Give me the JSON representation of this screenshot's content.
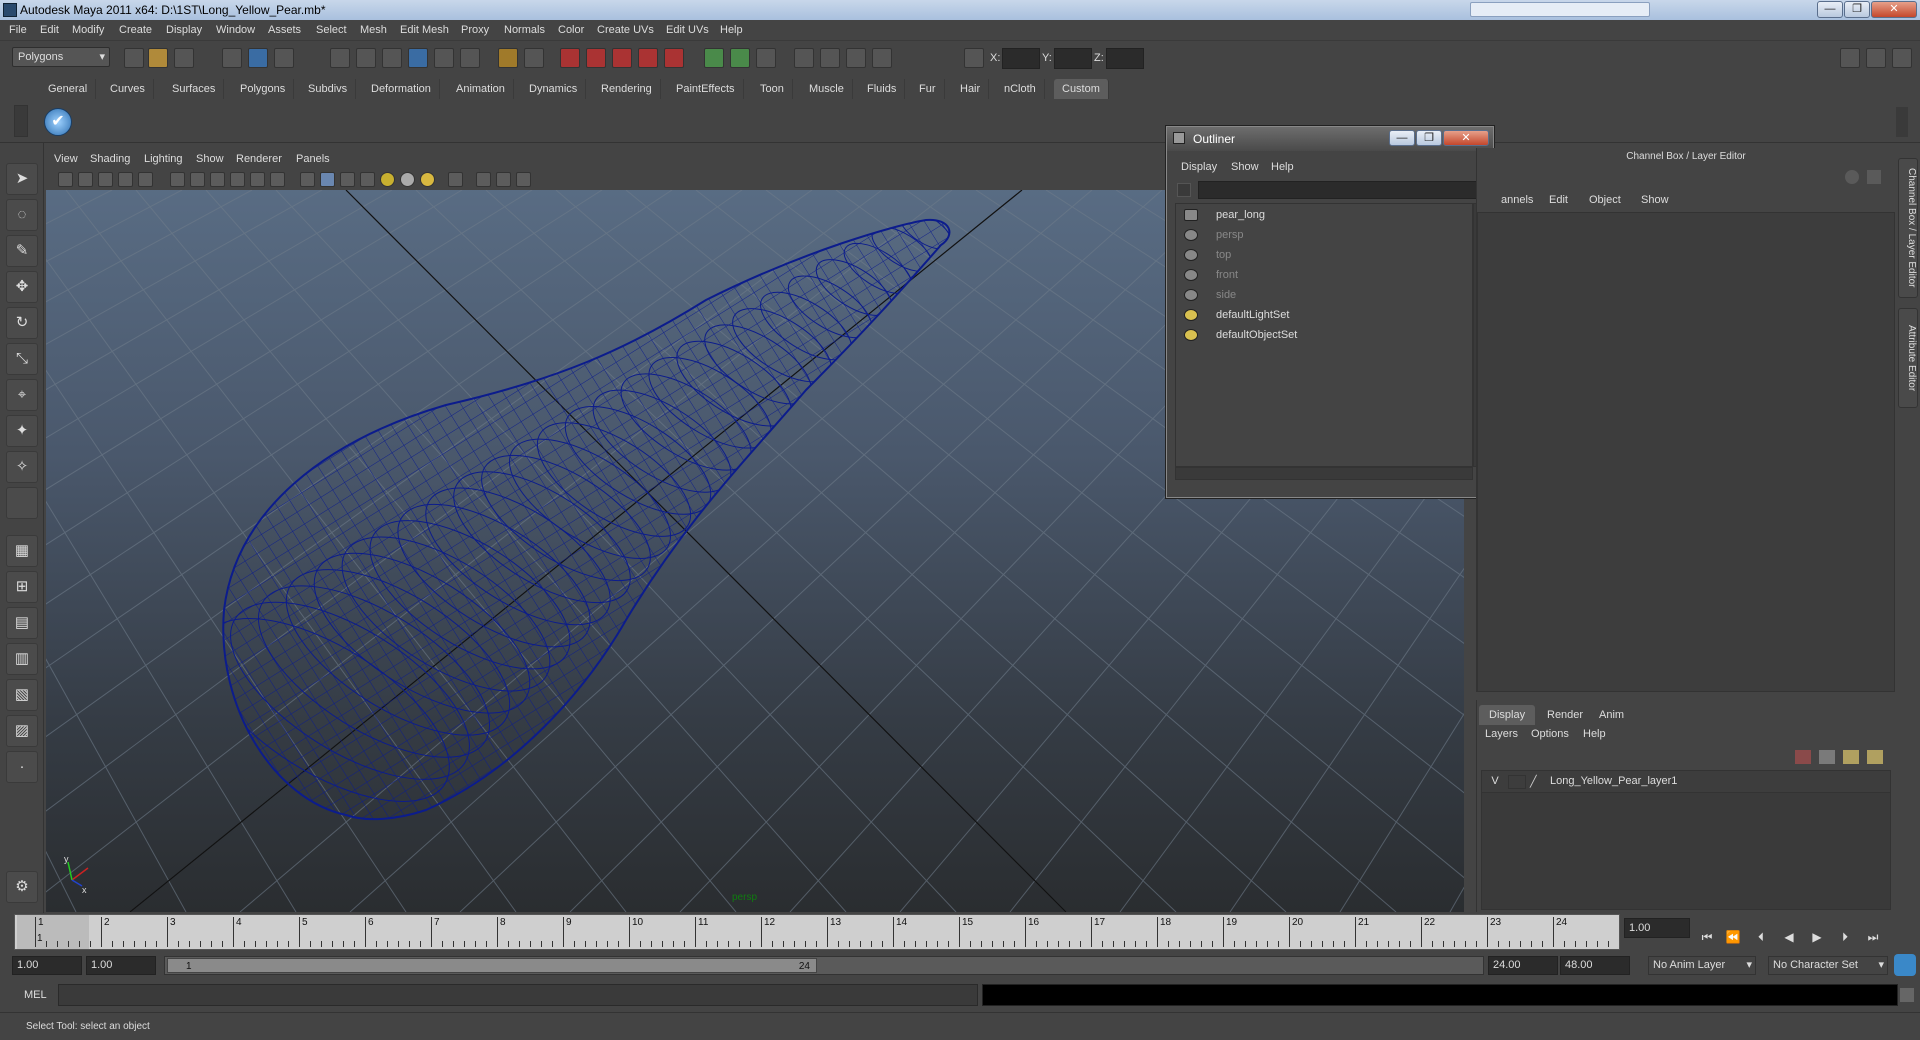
{
  "window": {
    "title": "Autodesk Maya 2011 x64: D:\\1ST\\Long_Yellow_Pear.mb*",
    "min_glyph": "—",
    "max_glyph": "❐",
    "close_glyph": "✕"
  },
  "menubar": [
    "File",
    "Edit",
    "Modify",
    "Create",
    "Display",
    "Window",
    "Assets",
    "Select",
    "Mesh",
    "Edit Mesh",
    "Proxy",
    "Normals",
    "Color",
    "Create UVs",
    "Edit UVs",
    "Help"
  ],
  "statusline": {
    "mode_select": "Polygons",
    "x_label": "X:",
    "y_label": "Y:",
    "z_label": "Z:"
  },
  "shelf": {
    "tabs": [
      "General",
      "Curves",
      "Surfaces",
      "Polygons",
      "Subdivs",
      "Deformation",
      "Animation",
      "Dynamics",
      "Rendering",
      "PaintEffects",
      "Toon",
      "Muscle",
      "Fluids",
      "Fur",
      "Hair",
      "nCloth",
      "Custom"
    ],
    "active_tab": "Custom"
  },
  "viewport": {
    "menu": [
      "View",
      "Shading",
      "Lighting",
      "Show",
      "Renderer",
      "Panels"
    ],
    "camera_label": "persp",
    "wire_color": "#0c1c8c",
    "bg_top": "#5b6f87",
    "bg_bottom": "#2a2d30"
  },
  "outliner": {
    "title": "Outliner",
    "menu": [
      "Display",
      "Show",
      "Help"
    ],
    "items": [
      {
        "label": "pear_long",
        "dim": false,
        "icon": "mesh-icon"
      },
      {
        "label": "persp",
        "dim": true,
        "icon": "camera-icon"
      },
      {
        "label": "top",
        "dim": true,
        "icon": "camera-icon"
      },
      {
        "label": "front",
        "dim": true,
        "icon": "camera-icon"
      },
      {
        "label": "side",
        "dim": true,
        "icon": "camera-icon"
      },
      {
        "label": "defaultLightSet",
        "dim": false,
        "icon": "set-icon"
      },
      {
        "label": "defaultObjectSet",
        "dim": false,
        "icon": "set-icon"
      }
    ]
  },
  "channel_box": {
    "title": "Channel Box / Layer Editor",
    "menu": [
      "annels",
      "Edit",
      "Object",
      "Show"
    ]
  },
  "side_tabs": [
    "Channel Box / Layer Editor",
    "Attribute Editor"
  ],
  "layer_editor": {
    "tabs": [
      "Display",
      "Render",
      "Anim"
    ],
    "active_tab": "Display",
    "menu": [
      "Layers",
      "Options",
      "Help"
    ],
    "layers": [
      {
        "visible": "V",
        "name": "Long_Yellow_Pear_layer1"
      }
    ]
  },
  "time_slider": {
    "frames": [
      "1",
      "2",
      "3",
      "4",
      "5",
      "6",
      "7",
      "8",
      "9",
      "10",
      "11",
      "12",
      "13",
      "14",
      "15",
      "16",
      "17",
      "18",
      "19",
      "20",
      "21",
      "22",
      "23",
      "24"
    ],
    "current_frame": "1",
    "current_time_field": "1.00"
  },
  "range_slider": {
    "start_time": "1.00",
    "playback_start": "1.00",
    "range_start_label": "1",
    "range_end_label": "24",
    "playback_end": "24.00",
    "end_time": "48.00",
    "anim_layer": "No Anim Layer",
    "character_set": "No Character Set"
  },
  "command_line": {
    "label": "MEL"
  },
  "help_line": {
    "text": "Select Tool: select an object"
  }
}
